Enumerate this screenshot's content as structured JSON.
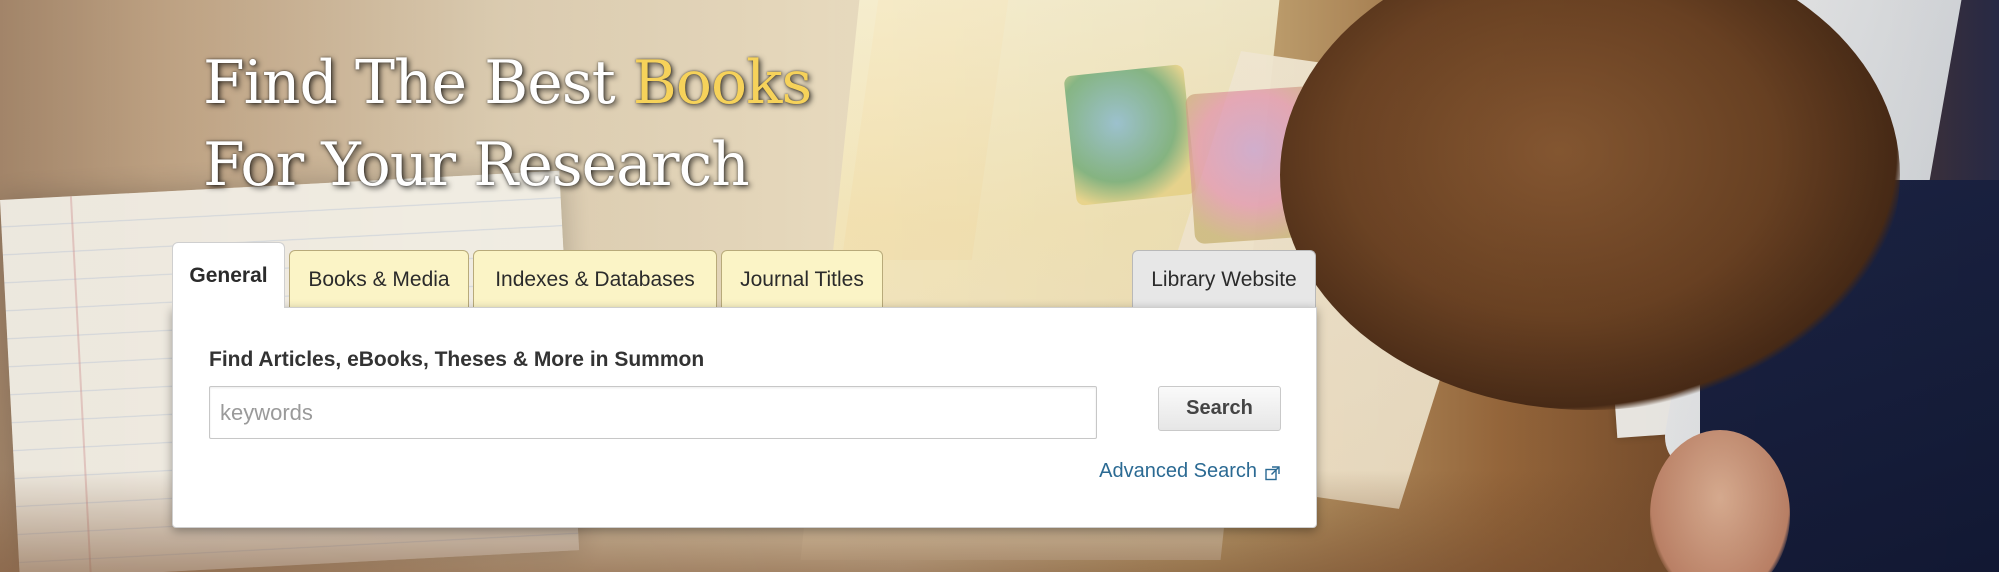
{
  "hero": {
    "title_line1_prefix": "Find The Best ",
    "title_line1_accent": "Books",
    "title_line2": "For Your Research",
    "accent_color": "#f6d25a"
  },
  "tabs": [
    {
      "label": "General",
      "active": true
    },
    {
      "label": "Books & Media",
      "active": false
    },
    {
      "label": "Indexes & Databases",
      "active": false
    },
    {
      "label": "Journal Titles",
      "active": false
    },
    {
      "label": "Library Website",
      "active": false
    }
  ],
  "search_panel": {
    "heading": "Find Articles, eBooks, Theses & More in Summon",
    "input_value": "",
    "input_placeholder": "keywords",
    "button_label": "Search",
    "advanced_link_label": "Advanced Search",
    "advanced_link_icon": "external-link-icon"
  },
  "colors": {
    "tab_background": "#fbf4c6",
    "tab_gray_background": "#e7e7e7",
    "link_color": "#2b6a93"
  }
}
